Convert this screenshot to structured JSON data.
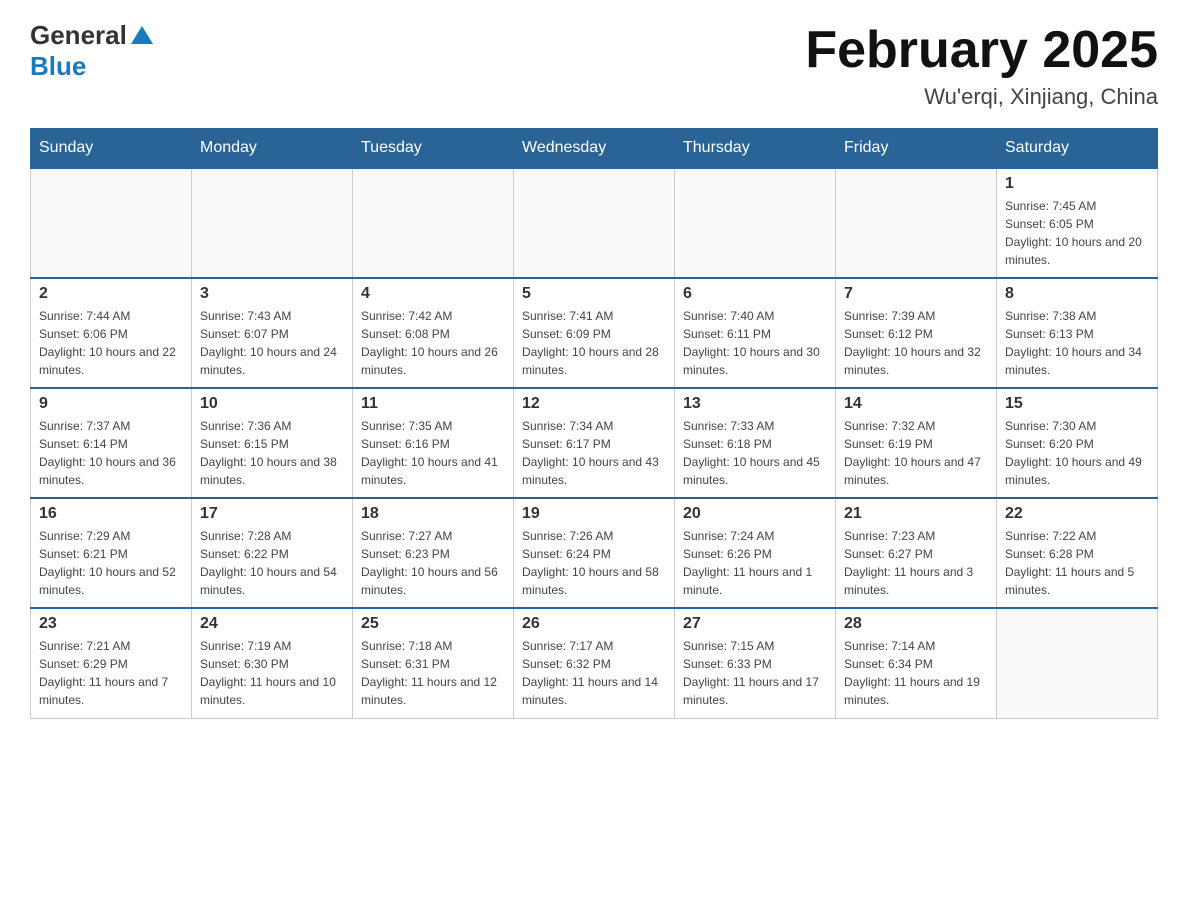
{
  "header": {
    "logo": {
      "general": "General",
      "blue": "Blue"
    },
    "title": "February 2025",
    "location": "Wu'erqi, Xinjiang, China"
  },
  "weekdays": [
    "Sunday",
    "Monday",
    "Tuesday",
    "Wednesday",
    "Thursday",
    "Friday",
    "Saturday"
  ],
  "weeks": [
    [
      {
        "day": "",
        "info": ""
      },
      {
        "day": "",
        "info": ""
      },
      {
        "day": "",
        "info": ""
      },
      {
        "day": "",
        "info": ""
      },
      {
        "day": "",
        "info": ""
      },
      {
        "day": "",
        "info": ""
      },
      {
        "day": "1",
        "info": "Sunrise: 7:45 AM\nSunset: 6:05 PM\nDaylight: 10 hours and 20 minutes."
      }
    ],
    [
      {
        "day": "2",
        "info": "Sunrise: 7:44 AM\nSunset: 6:06 PM\nDaylight: 10 hours and 22 minutes."
      },
      {
        "day": "3",
        "info": "Sunrise: 7:43 AM\nSunset: 6:07 PM\nDaylight: 10 hours and 24 minutes."
      },
      {
        "day": "4",
        "info": "Sunrise: 7:42 AM\nSunset: 6:08 PM\nDaylight: 10 hours and 26 minutes."
      },
      {
        "day": "5",
        "info": "Sunrise: 7:41 AM\nSunset: 6:09 PM\nDaylight: 10 hours and 28 minutes."
      },
      {
        "day": "6",
        "info": "Sunrise: 7:40 AM\nSunset: 6:11 PM\nDaylight: 10 hours and 30 minutes."
      },
      {
        "day": "7",
        "info": "Sunrise: 7:39 AM\nSunset: 6:12 PM\nDaylight: 10 hours and 32 minutes."
      },
      {
        "day": "8",
        "info": "Sunrise: 7:38 AM\nSunset: 6:13 PM\nDaylight: 10 hours and 34 minutes."
      }
    ],
    [
      {
        "day": "9",
        "info": "Sunrise: 7:37 AM\nSunset: 6:14 PM\nDaylight: 10 hours and 36 minutes."
      },
      {
        "day": "10",
        "info": "Sunrise: 7:36 AM\nSunset: 6:15 PM\nDaylight: 10 hours and 38 minutes."
      },
      {
        "day": "11",
        "info": "Sunrise: 7:35 AM\nSunset: 6:16 PM\nDaylight: 10 hours and 41 minutes."
      },
      {
        "day": "12",
        "info": "Sunrise: 7:34 AM\nSunset: 6:17 PM\nDaylight: 10 hours and 43 minutes."
      },
      {
        "day": "13",
        "info": "Sunrise: 7:33 AM\nSunset: 6:18 PM\nDaylight: 10 hours and 45 minutes."
      },
      {
        "day": "14",
        "info": "Sunrise: 7:32 AM\nSunset: 6:19 PM\nDaylight: 10 hours and 47 minutes."
      },
      {
        "day": "15",
        "info": "Sunrise: 7:30 AM\nSunset: 6:20 PM\nDaylight: 10 hours and 49 minutes."
      }
    ],
    [
      {
        "day": "16",
        "info": "Sunrise: 7:29 AM\nSunset: 6:21 PM\nDaylight: 10 hours and 52 minutes."
      },
      {
        "day": "17",
        "info": "Sunrise: 7:28 AM\nSunset: 6:22 PM\nDaylight: 10 hours and 54 minutes."
      },
      {
        "day": "18",
        "info": "Sunrise: 7:27 AM\nSunset: 6:23 PM\nDaylight: 10 hours and 56 minutes."
      },
      {
        "day": "19",
        "info": "Sunrise: 7:26 AM\nSunset: 6:24 PM\nDaylight: 10 hours and 58 minutes."
      },
      {
        "day": "20",
        "info": "Sunrise: 7:24 AM\nSunset: 6:26 PM\nDaylight: 11 hours and 1 minute."
      },
      {
        "day": "21",
        "info": "Sunrise: 7:23 AM\nSunset: 6:27 PM\nDaylight: 11 hours and 3 minutes."
      },
      {
        "day": "22",
        "info": "Sunrise: 7:22 AM\nSunset: 6:28 PM\nDaylight: 11 hours and 5 minutes."
      }
    ],
    [
      {
        "day": "23",
        "info": "Sunrise: 7:21 AM\nSunset: 6:29 PM\nDaylight: 11 hours and 7 minutes."
      },
      {
        "day": "24",
        "info": "Sunrise: 7:19 AM\nSunset: 6:30 PM\nDaylight: 11 hours and 10 minutes."
      },
      {
        "day": "25",
        "info": "Sunrise: 7:18 AM\nSunset: 6:31 PM\nDaylight: 11 hours and 12 minutes."
      },
      {
        "day": "26",
        "info": "Sunrise: 7:17 AM\nSunset: 6:32 PM\nDaylight: 11 hours and 14 minutes."
      },
      {
        "day": "27",
        "info": "Sunrise: 7:15 AM\nSunset: 6:33 PM\nDaylight: 11 hours and 17 minutes."
      },
      {
        "day": "28",
        "info": "Sunrise: 7:14 AM\nSunset: 6:34 PM\nDaylight: 11 hours and 19 minutes."
      },
      {
        "day": "",
        "info": ""
      }
    ]
  ]
}
